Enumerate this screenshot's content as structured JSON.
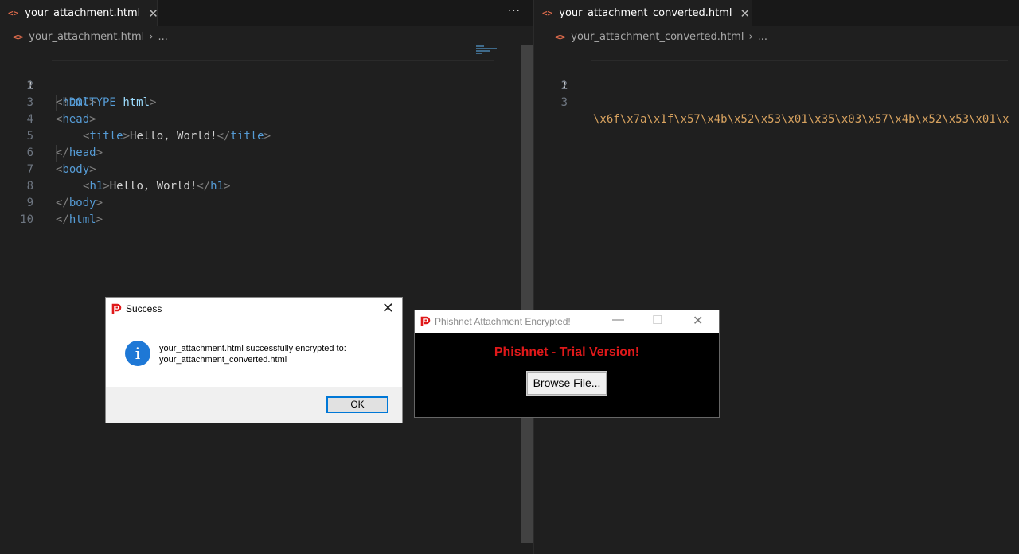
{
  "left_editor": {
    "tab_title": "your_attachment.html",
    "tab_close": "✕",
    "more_actions": "···",
    "breadcrumb_file": "your_attachment.html",
    "breadcrumb_sep": "›",
    "breadcrumb_more": "...",
    "line_numbers": [
      "1",
      "2",
      "3",
      "4",
      "5",
      "6",
      "7",
      "8",
      "9",
      "10"
    ],
    "code": {
      "l1_open": "<!",
      "l1_keyword": "DOCTYPE",
      "l1_arg": "html",
      "l1_close": ">",
      "l2_tag": "html",
      "l3_tag": "head",
      "l4_tag_open": "title",
      "l4_text": "Hello, World!",
      "l4_tag_close": "title",
      "l5_tag": "head",
      "l6_tag": "body",
      "l7_tag_open": "h1",
      "l7_text": "Hello, World!",
      "l7_tag_close": "h1",
      "l8_tag": "body",
      "l9_tag": "html"
    }
  },
  "right_editor": {
    "tab_title": "your_attachment_converted.html",
    "tab_close": "✕",
    "breadcrumb_file": "your_attachment_converted.html",
    "breadcrumb_sep": "›",
    "breadcrumb_more": "...",
    "line_numbers": [
      "1",
      "2",
      "3"
    ],
    "line3_text": "\\x6f\\x7a\\x1f\\x57\\x4b\\x52\\x53\\x01\\x35\\x03\\x57\\x4b\\x52\\x53\\x01\\x"
  },
  "success_dialog": {
    "title": "Success",
    "close": "✕",
    "info_glyph": "i",
    "message_line1": "your_attachment.html successfully encrypted to:",
    "message_line2": "your_attachment_converted.html",
    "ok_label": "OK"
  },
  "phishnet_window": {
    "title": "Phishnet Attachment Encrypted!",
    "minimize": "—",
    "maximize": "☐",
    "close": "✕",
    "heading": "Phishnet - Trial Version!",
    "browse_label": "Browse File..."
  },
  "colors": {
    "editor_bg": "#1f1f1f",
    "tag": "#569cd6",
    "string": "#d7a25f",
    "phishnet_red": "#e0191a",
    "info_blue": "#1e78d6"
  }
}
